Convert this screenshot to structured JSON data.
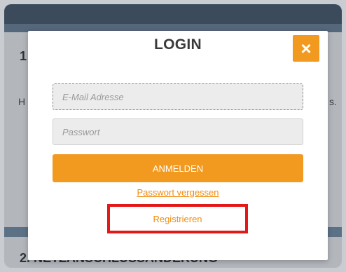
{
  "background": {
    "section1_number": "1",
    "section1_left_fragment": "H",
    "section1_right_fragment": "s.",
    "section2_title": "2. NETZANSCHLUSSÄNDERUNG"
  },
  "modal": {
    "title": "LOGIN",
    "close_label": "×",
    "email_placeholder": "E-Mail Adresse",
    "password_placeholder": "Passwort",
    "login_button": "ANMELDEN",
    "forgot_link": "Passwort vergessen",
    "register_link": "Registrieren"
  },
  "colors": {
    "accent": "#f29a1f",
    "link": "#ef8c10",
    "highlight": "#e51818"
  }
}
